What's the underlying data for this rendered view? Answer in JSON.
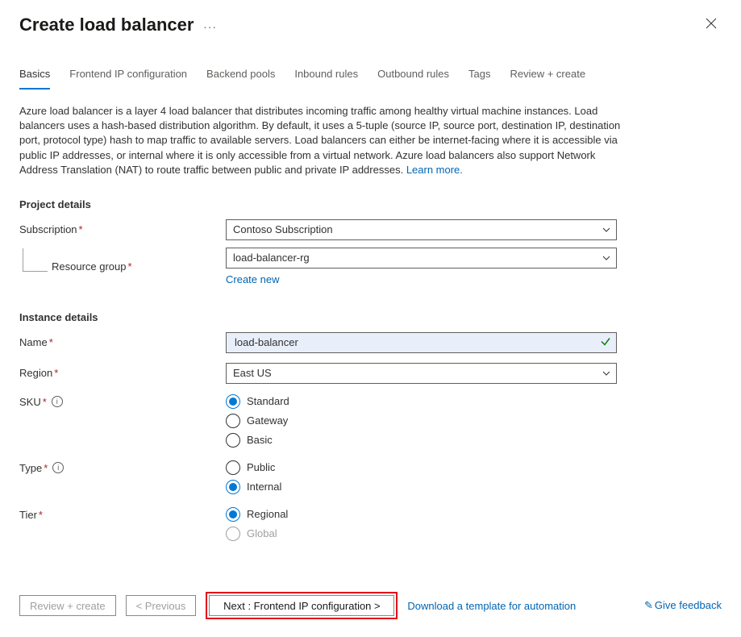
{
  "header": {
    "title": "Create load balancer",
    "more": "···"
  },
  "tabs": {
    "items": [
      {
        "label": "Basics",
        "active": true
      },
      {
        "label": "Frontend IP configuration",
        "active": false
      },
      {
        "label": "Backend pools",
        "active": false
      },
      {
        "label": "Inbound rules",
        "active": false
      },
      {
        "label": "Outbound rules",
        "active": false
      },
      {
        "label": "Tags",
        "active": false
      },
      {
        "label": "Review + create",
        "active": false
      }
    ]
  },
  "description": {
    "text": "Azure load balancer is a layer 4 load balancer that distributes incoming traffic among healthy virtual machine instances. Load balancers uses a hash-based distribution algorithm. By default, it uses a 5-tuple (source IP, source port, destination IP, destination port, protocol type) hash to map traffic to available servers. Load balancers can either be internet-facing where it is accessible via public IP addresses, or internal where it is only accessible from a virtual network. Azure load balancers also support Network Address Translation (NAT) to route traffic between public and private IP addresses.  ",
    "learn_more": "Learn more."
  },
  "sections": {
    "project_details": "Project details",
    "instance_details": "Instance details"
  },
  "fields": {
    "subscription": {
      "label": "Subscription",
      "value": "Contoso Subscription"
    },
    "resource_group": {
      "label": "Resource group",
      "value": "load-balancer-rg",
      "create_new": "Create new"
    },
    "name": {
      "label": "Name",
      "value": "load-balancer"
    },
    "region": {
      "label": "Region",
      "value": "East US"
    },
    "sku": {
      "label": "SKU",
      "options": [
        "Standard",
        "Gateway",
        "Basic"
      ],
      "selected": "Standard"
    },
    "type": {
      "label": "Type",
      "options": [
        "Public",
        "Internal"
      ],
      "selected": "Internal"
    },
    "tier": {
      "label": "Tier",
      "options": [
        "Regional",
        "Global"
      ],
      "selected": "Regional",
      "disabled": [
        "Global"
      ]
    }
  },
  "footer": {
    "review_create": "Review + create",
    "previous": "< Previous",
    "next": "Next : Frontend IP configuration >",
    "download_template": "Download a template for automation",
    "give_feedback": "Give feedback"
  }
}
